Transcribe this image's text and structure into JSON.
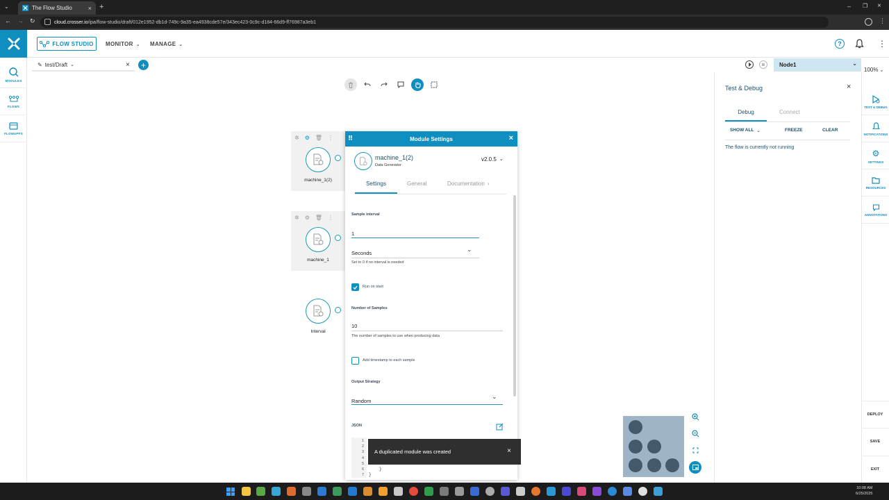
{
  "browser": {
    "tab_title": "The Flow Studio",
    "url_host": "cloud.crosser.io",
    "url_path": "/ipa/flow-studio/draft/012e1952-db1d-749c-9a35-ea4938cde57e/343ec423-0c9c-d184-66d9-ff76987a3eb1"
  },
  "header": {
    "flow_studio": "FLOW STUDIO",
    "monitor": "MONITOR",
    "manage": "MANAGE"
  },
  "left_sidebar": {
    "items": [
      {
        "label": "MODULES"
      },
      {
        "label": "FLOWS"
      },
      {
        "label": "FLOWAPPS"
      }
    ]
  },
  "tabs": {
    "draft_label": "test/Draft",
    "add": "+"
  },
  "node": {
    "selected": "Node1",
    "zoom": "100%"
  },
  "canvas": {
    "modules": [
      {
        "label": "machine_1(2)"
      },
      {
        "label": "machine_1"
      },
      {
        "label": "Interval"
      }
    ]
  },
  "settings": {
    "title": "Module Settings",
    "module_name": "machine_1(2)",
    "module_type": "Data Generator",
    "version": "v2.0.5",
    "tabs": [
      {
        "label": "Settings"
      },
      {
        "label": "General"
      },
      {
        "label": "Documentation"
      }
    ],
    "sample_interval_label": "Sample interval",
    "sample_interval_value": "1",
    "unit_value": "Seconds",
    "interval_hint": "Set to 0 if no interval is needed",
    "run_on_start_label": "Run on start",
    "run_on_start_checked": true,
    "num_samples_label": "Number of Samples",
    "num_samples_value": "10",
    "num_samples_hint": "The number of samples to use when producing data",
    "timestamp_label": "Add timestamp to each sample",
    "timestamp_checked": false,
    "output_strategy_label": "Output Strategy",
    "output_strategy_value": "Random",
    "json_label": "JSON",
    "json_lines": [
      "1",
      "2",
      "3",
      "4",
      "5",
      "6",
      "7"
    ],
    "json_code_6": "}",
    "json_code_7": "}"
  },
  "toast": {
    "message": "A duplicated module was created"
  },
  "debug": {
    "title": "Test & Debug",
    "tab_debug": "Debug",
    "tab_connect": "Connect",
    "show_all": "SHOW ALL",
    "freeze": "FREEZE",
    "clear": "CLEAR",
    "status": "The flow is currently not running"
  },
  "right_sidebar": {
    "items": [
      {
        "label": "TEST & DEBUG"
      },
      {
        "label": "NOTIFICATIONS"
      },
      {
        "label": "SETTINGS"
      },
      {
        "label": "RESOURCES"
      },
      {
        "label": "ANNOTATIONS"
      }
    ],
    "deploy": "DEPLOY",
    "save": "SAVE",
    "exit": "EXIT"
  },
  "taskbar": {
    "time": "10:08 AM",
    "date": "6/25/2025"
  },
  "colors": {
    "accent": "#0f8ec0",
    "module_stroke": "#1d9ab0",
    "toast_bg": "#2f2f2f",
    "node_select_bg": "#cde6f2"
  }
}
